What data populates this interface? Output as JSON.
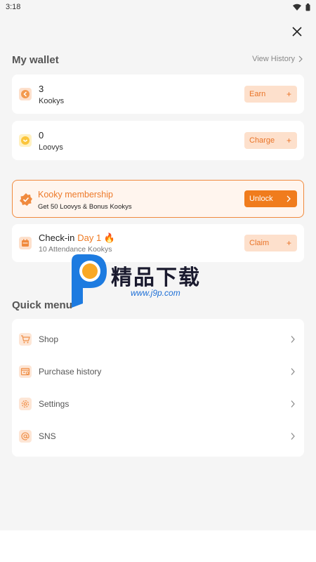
{
  "status_bar": {
    "time": "3:18"
  },
  "wallet": {
    "title": "My wallet",
    "view_history": "View History",
    "kookys": {
      "value": "3",
      "unit": "Kookys",
      "action": "Earn"
    },
    "loovys": {
      "value": "0",
      "unit": "Loovys",
      "action": "Charge"
    }
  },
  "membership": {
    "title": "Kooky membership",
    "subtitle": "Get 50 Loovys & Bonus Kookys",
    "action": "Unlock"
  },
  "checkin": {
    "title": "Check-in",
    "day": "Day 1 🔥",
    "subtitle": "10 Attendance Kookys",
    "action": "Claim"
  },
  "quick_menu": {
    "title": "Quick menu",
    "items": [
      {
        "label": "Shop",
        "icon": "cart-icon"
      },
      {
        "label": "Purchase history",
        "icon": "receipt-icon"
      },
      {
        "label": "Settings",
        "icon": "gear-icon"
      },
      {
        "label": "SNS",
        "icon": "at-icon"
      }
    ]
  },
  "watermark": {
    "text": "精品下载",
    "url": "www.j9p.com"
  },
  "colors": {
    "accent": "#f07c1d",
    "accent_light": "#fde0cc",
    "background": "#f5f5f5"
  }
}
